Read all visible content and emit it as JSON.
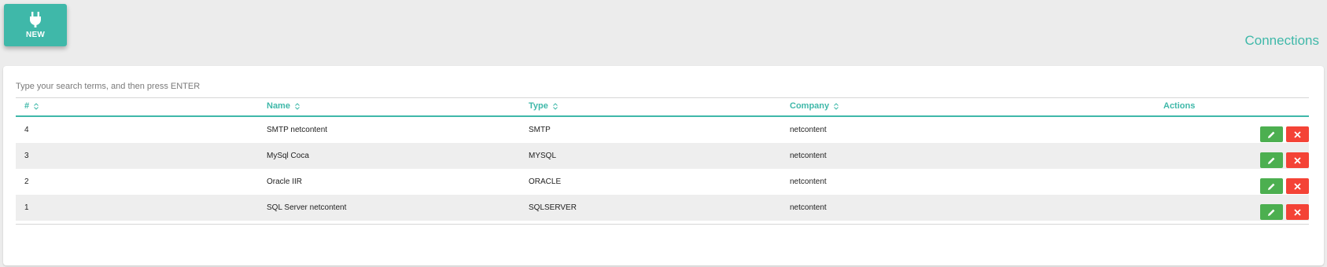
{
  "header": {
    "new_button_label": "NEW",
    "new_button_icon": "plug-icon",
    "page_title": "Connections"
  },
  "search": {
    "placeholder": "Type your search terms, and then press ENTER"
  },
  "table": {
    "columns": [
      "#",
      "Name",
      "Type",
      "Company",
      "Actions"
    ],
    "rows": [
      {
        "id": "4",
        "name": "SMTP netcontent",
        "type": "SMTP",
        "company": "netcontent"
      },
      {
        "id": "3",
        "name": "MySql Coca",
        "type": "MYSQL",
        "company": "netcontent"
      },
      {
        "id": "2",
        "name": "Oracle IIR",
        "type": "ORACLE",
        "company": "netcontent"
      },
      {
        "id": "1",
        "name": "SQL Server netcontent",
        "type": "SQLSERVER",
        "company": "netcontent"
      }
    ]
  },
  "colors": {
    "accent": "#3fb8a9",
    "edit": "#4caf50",
    "delete": "#f44336"
  }
}
